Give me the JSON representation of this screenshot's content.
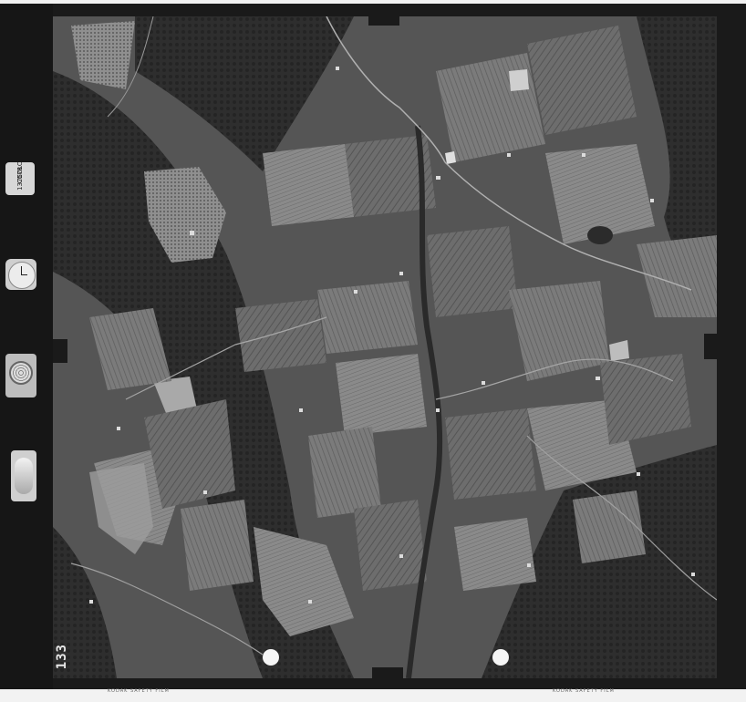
{
  "image": {
    "kind": "aerial photograph",
    "tone": "black-and-white"
  },
  "margin": {
    "label_card": [
      "COLOR",
      "C178",
      "1375"
    ],
    "frame_number": "133",
    "film_text_left": "KODAK SAFETY FILM",
    "film_text_right": "KODAK SAFETY FILM"
  },
  "icons": {
    "clock": "clock-icon",
    "altimeter": "altimeter-icon",
    "level": "level-bubble-icon"
  },
  "colors": {
    "film": "#1a1a1a",
    "paper": "#f2f2f2"
  }
}
